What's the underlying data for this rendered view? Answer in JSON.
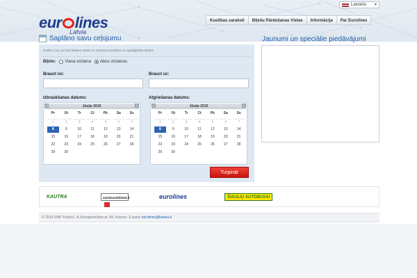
{
  "header": {
    "logo_text": "eurolines",
    "logo_sub": "Latvia",
    "language": "Latviešu",
    "nav": [
      "Kustības saraksti",
      "Biļešu Pārdošanas Vietas",
      "Informācija",
      "Par Eurolines"
    ]
  },
  "planner": {
    "title": "Saplāno savu ceļojumu",
    "hint": "Izvēlies, kur un kad vēlaties doties un saņemsit sarakstu un iegādājieties biļetes",
    "ticket_label": "Biļete:",
    "ticket_options": [
      "Viena virziena",
      "Abos virzienos"
    ],
    "ticket_selected": 1,
    "from_label": "Brauct no:",
    "from_value": "",
    "to_label": "Brauct uz:",
    "to_value": "",
    "depart_label": "Izbraukšanas datums:",
    "return_label": "Atgriešanas datums:",
    "submit": "Turpināt"
  },
  "calendar": {
    "month": "Jūsijs 2015",
    "weekdays": [
      "Pr",
      "Ot",
      "Tr",
      "Ct",
      "Pk",
      "Sa",
      "Sv"
    ],
    "weeks": [
      [
        "29",
        "30",
        "1",
        "2",
        "3",
        "4",
        "5"
      ],
      [
        "6",
        "7",
        "8",
        "9",
        "10",
        "11",
        "12"
      ],
      [
        "13",
        "14",
        "15",
        "16",
        "17",
        "18",
        "19"
      ],
      [
        "20",
        "21",
        "22",
        "23",
        "24",
        "25",
        "26"
      ],
      [
        "27",
        "28",
        "29",
        "30",
        "",
        "",
        ""
      ]
    ],
    "display_weeks": [
      [
        "1",
        "2",
        "3",
        "4",
        "5",
        "6",
        "7"
      ],
      [
        "8",
        "9",
        "10",
        "11",
        "12",
        "13",
        "14"
      ],
      [
        "15",
        "16",
        "17",
        "18",
        "19",
        "20",
        "21"
      ],
      [
        "22",
        "23",
        "24",
        "25",
        "26",
        "27",
        "28"
      ],
      [
        "29",
        "30",
        "",
        "",
        "",
        "",
        ""
      ]
    ],
    "selected_day": "8",
    "dim_days": [
      "1",
      "2",
      "3",
      "4",
      "5",
      "6",
      "7"
    ]
  },
  "news": {
    "title": "Jaunumi un speciālie piedāvājumi"
  },
  "partners": {
    "kautra": "KAUTRA",
    "autobusubilietai": "autobusubilietai.lt",
    "eurolines": "eurolines",
    "siauliu": "ŠIAULIŲ AUTOBUSAI"
  },
  "footer": {
    "text": "© 2014 UAB \"Kautra\", A.Juozapavičiaus pr. 84, Kaunas. E-pasts ",
    "email": "eurolines@kautra.lt"
  },
  "colors": {
    "accent": "#1f5fa8",
    "brand_red": "#e2231a",
    "panel_bg": "#dde8f3",
    "selected_day": "#2e63b5"
  }
}
